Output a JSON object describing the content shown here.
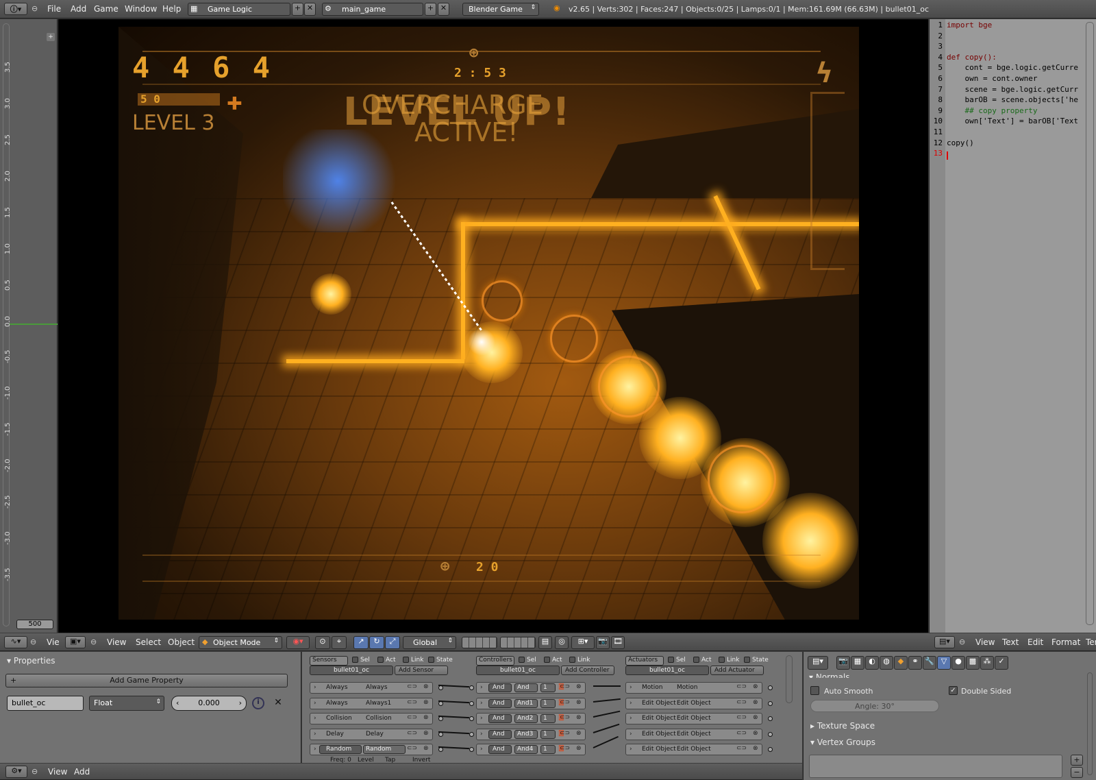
{
  "topbar": {
    "menus": [
      "File",
      "Add",
      "Game",
      "Window",
      "Help"
    ],
    "screen_layout": "Game Logic",
    "scene": "main_game",
    "engine": "Blender Game",
    "stats": "v2.65 | Verts:302 | Faces:247 | Objects:0/25 | Lamps:0/1 | Mem:161.69M (66.63M) | bullet01_oc"
  },
  "graph_editor": {
    "ruler": [
      "3.5",
      "3.0",
      "2.5",
      "2.0",
      "1.5",
      "1.0",
      "0.5",
      "0.0",
      "-0.5",
      "-1.0",
      "-1.5",
      "-2.0",
      "-2.5",
      "-3.0",
      "-3.5"
    ],
    "frame_field": "500",
    "menu": "Vie"
  },
  "game_hud": {
    "score": "4 4 6 4",
    "health": "5 0",
    "level": "LEVEL 3",
    "timer": "2 : 5 3",
    "overcharge_line1": "OVERCHARGE",
    "overcharge_line2": "ACTIVE!",
    "level_up": "LEVEL UP!",
    "ammo": "2 0"
  },
  "viewport_header": {
    "menus": [
      "View",
      "Select",
      "Object"
    ],
    "mode": "Object Mode",
    "orientation": "Global"
  },
  "text_editor": {
    "lines": [
      {
        "n": "1",
        "code": "import bge"
      },
      {
        "n": "2",
        "code": ""
      },
      {
        "n": "3",
        "code": ""
      },
      {
        "n": "4",
        "code": "def copy():"
      },
      {
        "n": "5",
        "code": "    cont = bge.logic.getCurre"
      },
      {
        "n": "6",
        "code": "    own = cont.owner"
      },
      {
        "n": "7",
        "code": "    scene = bge.logic.getCurr"
      },
      {
        "n": "8",
        "code": "    barOB = scene.objects['he"
      },
      {
        "n": "9",
        "code": "    ## copy property"
      },
      {
        "n": "10",
        "code": "    own['Text'] = barOB['Text"
      },
      {
        "n": "11",
        "code": ""
      },
      {
        "n": "12",
        "code": "copy()"
      },
      {
        "n": "13",
        "code": ""
      }
    ],
    "menus": [
      "View",
      "Text",
      "Edit",
      "Format",
      "Ter"
    ]
  },
  "properties_panel": {
    "title": "Properties",
    "add_button": "Add Game Property",
    "prop_name": "bullet_oc",
    "prop_type": "Float",
    "prop_value": "0.000"
  },
  "logic_editor": {
    "sensors": {
      "header": "Sensors",
      "flags": [
        "Sel",
        "Act",
        "Link",
        "State"
      ],
      "object": "bullet01_oc",
      "add": "Add Sensor",
      "items": [
        {
          "type": "Always",
          "name": "Always"
        },
        {
          "type": "Always",
          "name": "Always1"
        },
        {
          "type": "Collision",
          "name": "Collision"
        },
        {
          "type": "Delay",
          "name": "Delay"
        },
        {
          "type": "Random",
          "name": "Random"
        }
      ],
      "sub": [
        "Freq: 0",
        "Level",
        "Tap",
        "Invert"
      ]
    },
    "controllers": {
      "header": "Controllers",
      "flags": [
        "Sel",
        "Act",
        "Link"
      ],
      "object": "bullet01_oc",
      "add": "Add Controller",
      "items": [
        {
          "type": "And",
          "name": "And",
          "state": "1"
        },
        {
          "type": "And",
          "name": "And1",
          "state": "1"
        },
        {
          "type": "And",
          "name": "And2",
          "state": "1"
        },
        {
          "type": "And",
          "name": "And3",
          "state": "1"
        },
        {
          "type": "And",
          "name": "And4",
          "state": "1"
        }
      ]
    },
    "actuators": {
      "header": "Actuators",
      "flags": [
        "Sel",
        "Act",
        "Link",
        "State"
      ],
      "object": "bullet01_oc",
      "add": "Add Actuator",
      "items": [
        {
          "type": "Motion",
          "name": "Motion"
        },
        {
          "type": "Edit Object",
          "name": "Edit Object"
        },
        {
          "type": "Edit Object",
          "name": "Edit Object"
        },
        {
          "type": "Edit Object",
          "name": "Edit Object"
        },
        {
          "type": "Edit Object",
          "name": "Edit Object"
        }
      ]
    }
  },
  "object_data": {
    "normals_header": "Normals",
    "auto_smooth": "Auto Smooth",
    "double_sided": "Double Sided",
    "angle": "Angle: 30°",
    "texture_space": "Texture Space",
    "vertex_groups": "Vertex Groups"
  },
  "bottom_bar": {
    "menus": [
      "View",
      "Add"
    ]
  }
}
